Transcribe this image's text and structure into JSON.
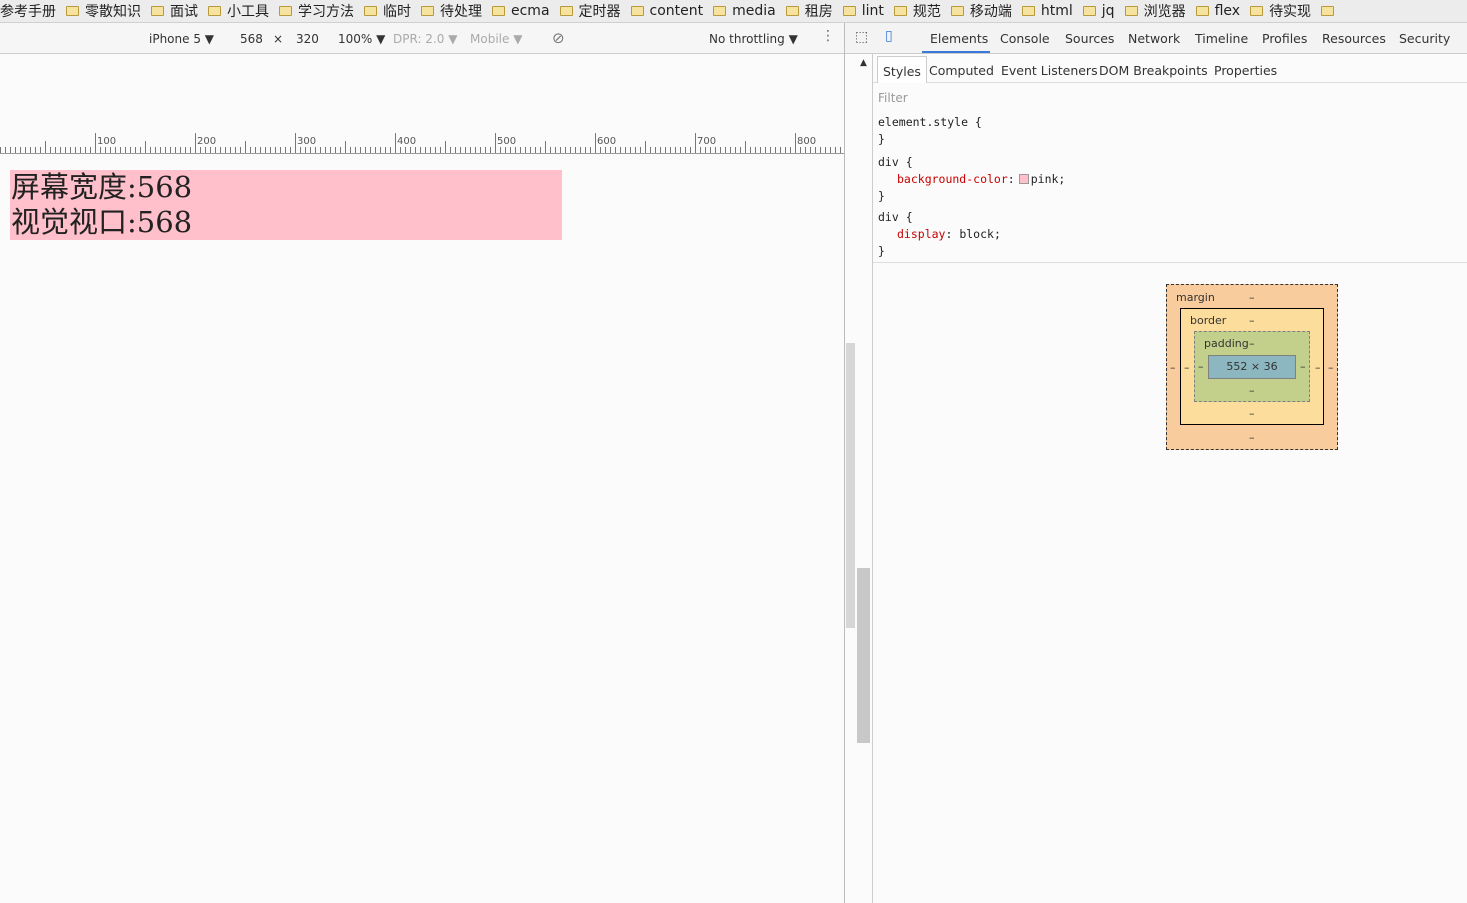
{
  "bookmarks": [
    "参考手册",
    "零散知识",
    "面试",
    "小工具",
    "学习方法",
    "临时",
    "待处理",
    "ecma",
    "定时器",
    "content",
    "media",
    "租房",
    "lint",
    "规范",
    "移动端",
    "html",
    "jq",
    "浏览器",
    "flex",
    "待实现"
  ],
  "device_toolbar": {
    "device": "iPhone 5",
    "width": "568",
    "times": "×",
    "height": "320",
    "zoom": "100%",
    "dpr": "DPR: 2.0",
    "mode": "Mobile",
    "throttling": "No throttling"
  },
  "ruler_labels": [
    "100",
    "200",
    "300",
    "400",
    "500",
    "600",
    "700",
    "800"
  ],
  "page": {
    "line1": "屏幕宽度:568",
    "line2": "视觉视口:568",
    "background": "#ffc0cb"
  },
  "devtools": {
    "tabs": [
      "Elements",
      "Console",
      "Sources",
      "Network",
      "Timeline",
      "Profiles",
      "Resources",
      "Security"
    ],
    "active_tab": "Elements",
    "subtabs": [
      "Styles",
      "Computed",
      "Event Listeners",
      "DOM Breakpoints",
      "Properties"
    ],
    "filter_placeholder": "Filter",
    "rules": {
      "r1_selector": "element.style {",
      "close": "}",
      "r2_selector": "div {",
      "r2_prop": "background-color",
      "r2_val": "pink;",
      "r3_selector": "div {",
      "r3_prop": "display",
      "r3_val": "block;"
    },
    "box_model": {
      "margin": "margin",
      "border": "border",
      "padding": "padding",
      "dash": "–",
      "content": "552 × 36"
    }
  }
}
